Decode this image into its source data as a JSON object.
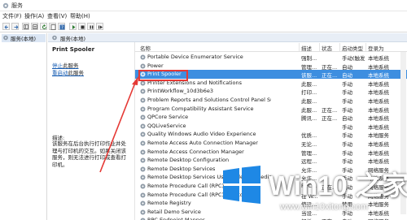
{
  "window": {
    "title": "服务"
  },
  "menu": {
    "items": [
      "文件(F)",
      "操作(A)",
      "查看(V)",
      "帮助(H)"
    ]
  },
  "tree": {
    "root_label": "服务(本地)"
  },
  "content_header": {
    "label": "服务(本地)"
  },
  "description_panel": {
    "service_name": "Print Spooler",
    "stop_link": "停止",
    "stop_suffix": "此服务",
    "restart_link": "重启动",
    "restart_suffix": "此服务",
    "desc_label": "描述:",
    "desc_text": "该服务在后台执行打印作业并处理与打印机的交互。如果关闭该服务，则无法进行打印或查看打印机。"
  },
  "columns": {
    "name": "名称",
    "desc": "描述",
    "status": "状态",
    "startup": "启动类型",
    "logon": "登录为"
  },
  "services": [
    {
      "name": "Portable Device Enumerator Service",
      "desc": "强制...",
      "status": "",
      "startup": "手动(触发...",
      "logon": "本地系统"
    },
    {
      "name": "Power",
      "desc": "管理...",
      "status": "正在...",
      "startup": "自动",
      "logon": "本地系统"
    },
    {
      "name": "Print Spooler",
      "desc": "该服...",
      "status": "正在...",
      "startup": "自动",
      "logon": "本地系统",
      "selected": true
    },
    {
      "name": "Printer Extensions and Notifications",
      "desc": "此服...",
      "status": "",
      "startup": "手动",
      "logon": "本地系统"
    },
    {
      "name": "PrintWorkflow_10d3b6e3",
      "desc": "打印...",
      "status": "",
      "startup": "手动",
      "logon": "本地系统"
    },
    {
      "name": "Problem Reports and Solutions Control Panel Support",
      "desc": "此服...",
      "status": "",
      "startup": "手动",
      "logon": "本地系统"
    },
    {
      "name": "Program Compatibility Assistant Service",
      "desc": "此服...",
      "status": "正在...",
      "startup": "手动",
      "logon": "本地系统"
    },
    {
      "name": "QPCore Service",
      "desc": "腾讯...",
      "status": "正在...",
      "startup": "自动",
      "logon": "本地系统"
    },
    {
      "name": "QQLiveService",
      "desc": "",
      "status": "",
      "startup": "手动",
      "logon": "本地系统"
    },
    {
      "name": "Quality Windows Audio Video Experience",
      "desc": "优质...",
      "status": "",
      "startup": "手动",
      "logon": "本地服务"
    },
    {
      "name": "Remote Access Auto Connection Manager",
      "desc": "无论...",
      "status": "",
      "startup": "手动",
      "logon": "本地系统"
    },
    {
      "name": "Remote Access Connection Manager",
      "desc": "管理...",
      "status": "",
      "startup": "手动",
      "logon": "本地系统"
    },
    {
      "name": "Remote Desktop Configuration",
      "desc": "远程...",
      "status": "",
      "startup": "手动",
      "logon": "本地系统"
    },
    {
      "name": "Remote Desktop Services",
      "desc": "允许...",
      "status": "",
      "startup": "手动",
      "logon": "网络服务"
    },
    {
      "name": "Remote Desktop Services UserMode Port Redirector",
      "desc": "允许...",
      "status": "",
      "startup": "手动",
      "logon": "本地系统"
    },
    {
      "name": "Remote Procedure Call (RPC)",
      "desc": "RPC...",
      "status": "正在...",
      "startup": "自动",
      "logon": "网络服务"
    },
    {
      "name": "Remote Procedure Call (RPC) Locator",
      "desc": "在 W...",
      "status": "",
      "startup": "手动",
      "logon": "网络服务"
    },
    {
      "name": "Remote Registry",
      "desc": "使远...",
      "status": "",
      "startup": "禁用",
      "logon": "本地服务"
    },
    {
      "name": "Retail Demo Service",
      "desc": "当设...",
      "status": "",
      "startup": "手动",
      "logon": "本地系统"
    },
    {
      "name": "RPC Endpoint Mapper",
      "desc": "解析...",
      "status": "正在...",
      "startup": "自动",
      "logon": "网络服务"
    }
  ],
  "watermark": {
    "brand": "Win10 之家",
    "url": "www.win10xitong.com"
  },
  "colors": {
    "selected_row": "#3d8ee0",
    "highlight": "#e53935",
    "link": "#1a5fb4",
    "logo_blue": "#1e88e5"
  }
}
